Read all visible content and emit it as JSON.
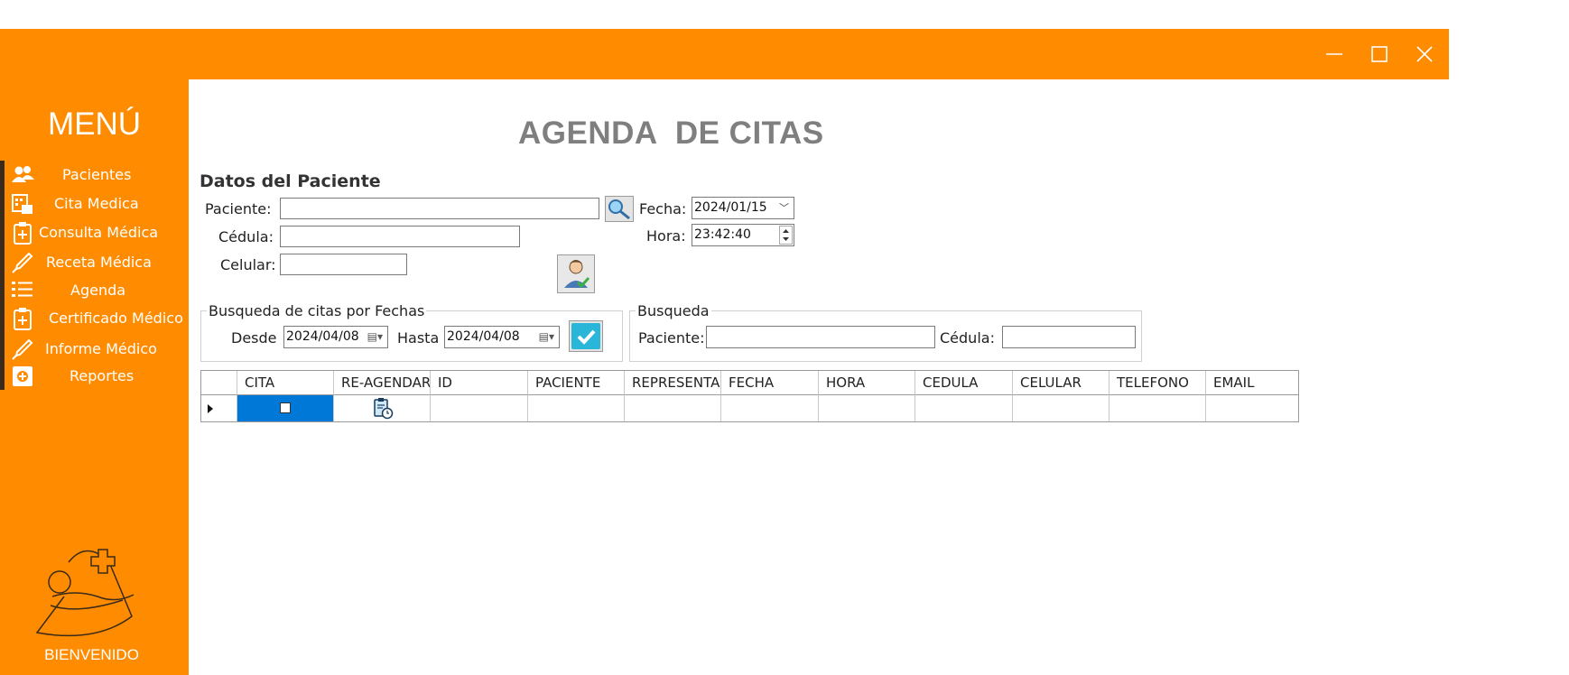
{
  "window": {
    "controls": [
      "minimize-icon",
      "maximize-icon",
      "close-icon"
    ],
    "accent_color": "#ff8c00"
  },
  "sidebar": {
    "title": "MENÚ",
    "items": [
      {
        "label": "Pacientes",
        "icon": "users-icon"
      },
      {
        "label": "Cita Medica",
        "icon": "calculator-calendar-icon"
      },
      {
        "label": "Consulta Médica",
        "icon": "clipboard-plus-icon"
      },
      {
        "label": "Receta Médica",
        "icon": "syringe-icon"
      },
      {
        "label": "Agenda",
        "icon": "list-icon"
      },
      {
        "label": "Certificado Médico",
        "icon": "clipboard-plus-icon"
      },
      {
        "label": "Informe Médico",
        "icon": "syringe-icon"
      },
      {
        "label": "Reportes",
        "icon": "report-icon"
      }
    ],
    "logo": "baby-care-logo",
    "footer": "BIENVENIDO"
  },
  "main": {
    "title": "AGENDA  DE CITAS",
    "patient_section": {
      "heading": "Datos del Paciente",
      "paciente_label": "Paciente:",
      "paciente_value": "",
      "cedula_label": "Cédula:",
      "cedula_value": "",
      "celular_label": "Celular:",
      "celular_value": "",
      "fecha_label": "Fecha:",
      "fecha_value": "2024/01/15",
      "hora_label": "Hora:",
      "hora_value": "23:42:40",
      "search_icon": "magnifier-icon",
      "add_patient_icon": "add-patient-icon"
    },
    "date_search": {
      "legend": "Busqueda de citas por Fechas",
      "desde_label": "Desde",
      "desde_value": "2024/04/08",
      "hasta_label": "Hasta",
      "hasta_value": "2024/04/08",
      "confirm_icon": "check-icon"
    },
    "search": {
      "legend": "Busqueda",
      "paciente_label": "Paciente:",
      "paciente_value": "",
      "cedula_label": "Cédula:",
      "cedula_value": ""
    },
    "table": {
      "columns": [
        "CITA",
        "RE-AGENDAR",
        "ID",
        "PACIENTE",
        "REPRESENTANTE",
        "FECHA",
        "HORA",
        "CEDULA",
        "CELULAR",
        "TELEFONO",
        "EMAIL"
      ],
      "rows": [
        {
          "cita_checked": false,
          "reagendar_icon": "clipboard-clock-icon",
          "id": "",
          "paciente": "",
          "representante": "",
          "fecha": "",
          "hora": "",
          "cedula": "",
          "celular": "",
          "telefono": "",
          "email": ""
        }
      ],
      "selected_color": "#0078d7"
    }
  }
}
